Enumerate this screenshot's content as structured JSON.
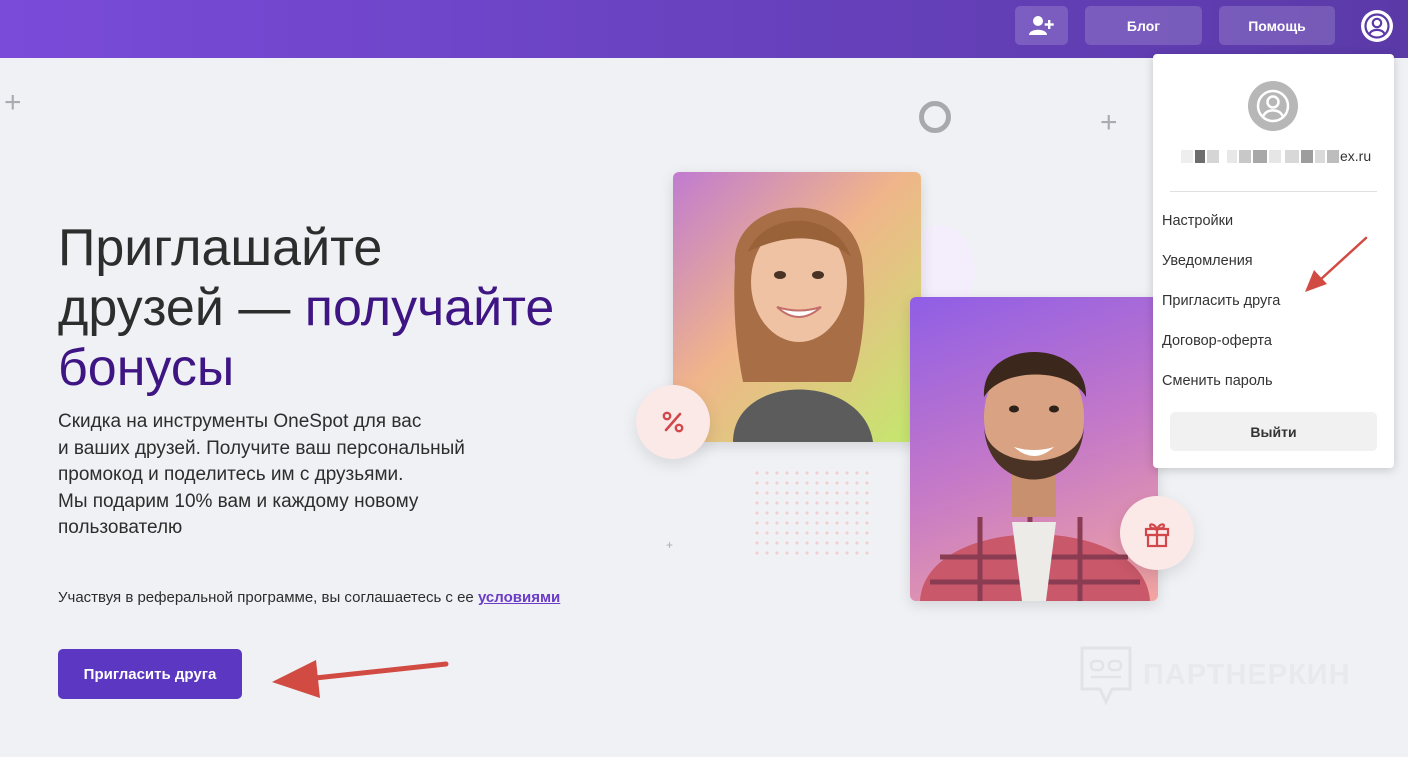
{
  "header": {
    "blog_label": "Блог",
    "help_label": "Помощь"
  },
  "hero": {
    "title_line1": "Приглашайте",
    "title_line2_plain": "друзей — ",
    "title_line2_accent": "получайте",
    "title_line3_accent": "бонусы",
    "desc_lines": [
      "Скидка на инструменты OneSpot для вас",
      "и ваших друзей. Получите ваш персональный",
      "промокод и поделитесь им с друзьями.",
      "Мы подарим 10% вам и каждому новому",
      "пользователю"
    ],
    "terms_text": "Участвуя в реферальной программе, вы соглашаетесь с ее ",
    "terms_link": "условиями",
    "cta_label": "Пригласить друга"
  },
  "user_menu": {
    "email_visible": "ex.ru",
    "items": [
      "Настройки",
      "Уведомления",
      "Пригласить друга",
      "Договор-оферта",
      "Сменить пароль"
    ],
    "logout_label": "Выйти"
  },
  "watermark": {
    "text": "ПАРТНЕРКИН"
  },
  "colors": {
    "header_gradient_start": "#7a4bd9",
    "header_gradient_end": "#5b3aa8",
    "accent": "#3e1583",
    "button": "#5c37c1",
    "annotation_arrow": "#d24b43"
  }
}
